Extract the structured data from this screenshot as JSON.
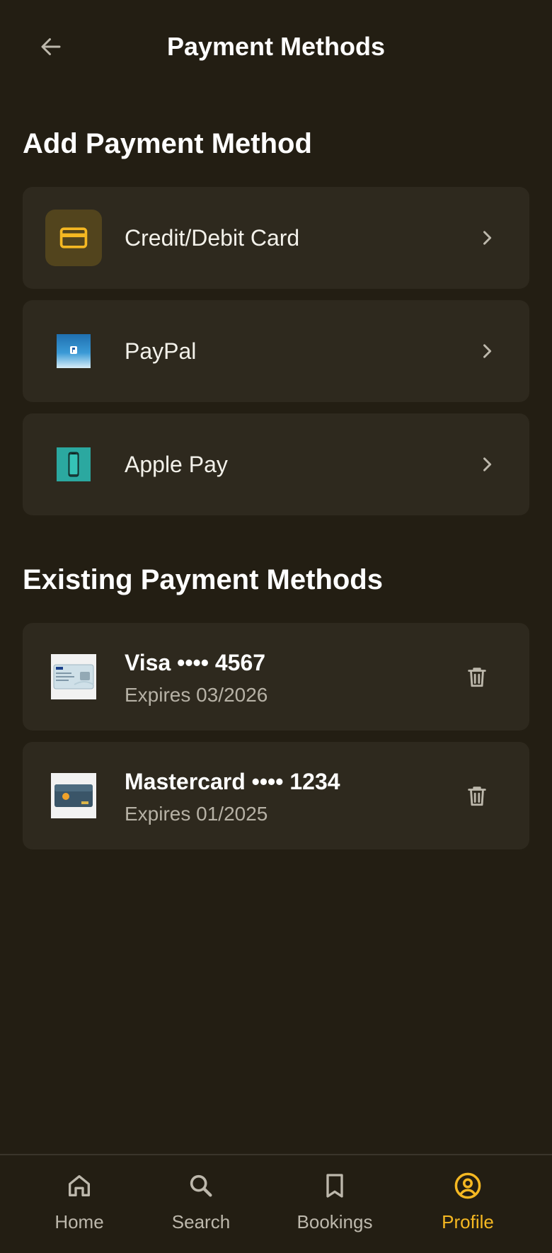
{
  "header": {
    "title": "Payment Methods",
    "back_icon": "arrow-left-icon"
  },
  "add_section": {
    "title": "Add Payment Method",
    "options": [
      {
        "label": "Credit/Debit Card",
        "icon": "credit-card-icon"
      },
      {
        "label": "PayPal",
        "icon": "paypal-image"
      },
      {
        "label": "Apple Pay",
        "icon": "apple-pay-phone-image"
      }
    ]
  },
  "existing_section": {
    "title": "Existing Payment Methods",
    "methods": [
      {
        "name": "Visa •••• 4567",
        "expiry": "Expires 03/2026",
        "icon": "visa-card-image"
      },
      {
        "name": "Mastercard •••• 1234",
        "expiry": "Expires 01/2025",
        "icon": "mastercard-card-image"
      }
    ]
  },
  "bottom_nav": {
    "items": [
      {
        "label": "Home",
        "icon": "home-icon",
        "active": false
      },
      {
        "label": "Search",
        "icon": "search-icon",
        "active": false
      },
      {
        "label": "Bookings",
        "icon": "bookmark-icon",
        "active": false
      },
      {
        "label": "Profile",
        "icon": "profile-icon",
        "active": true
      }
    ]
  },
  "colors": {
    "background": "#231e13",
    "card": "#2e291e",
    "accent": "#f5b822",
    "muted_text": "#b6b1a5"
  }
}
